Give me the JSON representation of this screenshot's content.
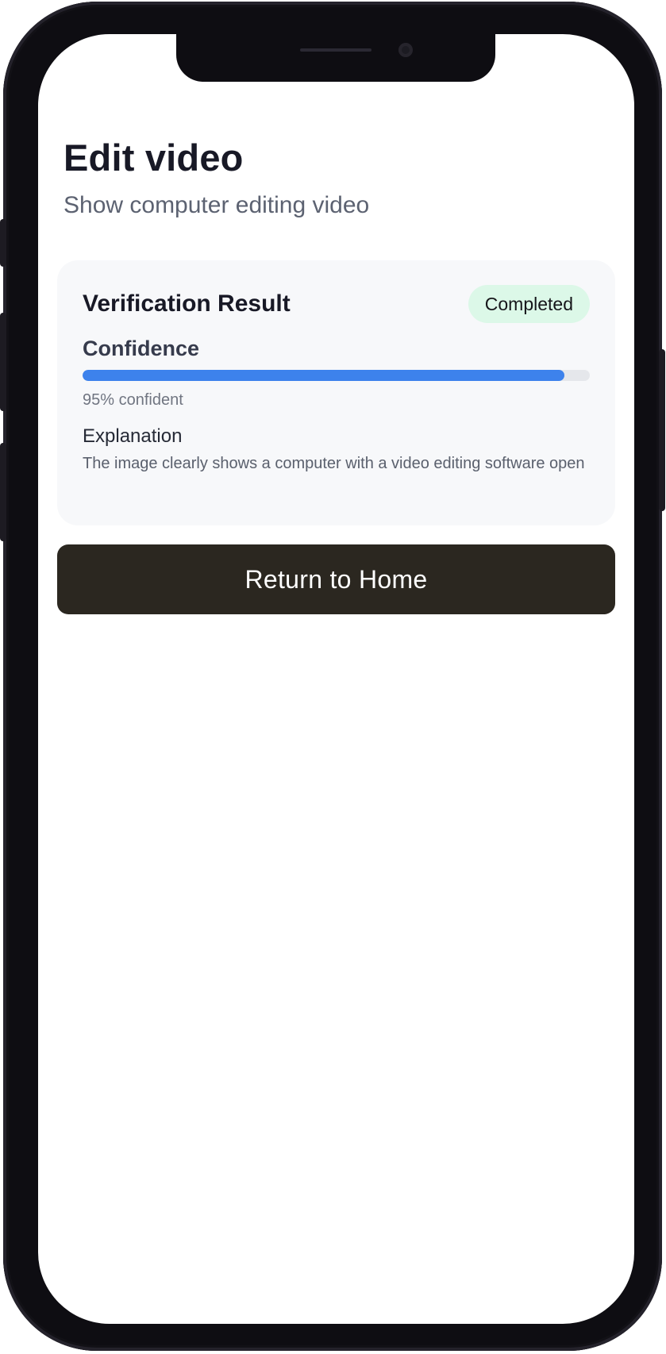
{
  "header": {
    "title": "Edit video",
    "subtitle": "Show computer editing video"
  },
  "result_card": {
    "title": "Verification Result",
    "status": "Completed",
    "status_color": "#dcf8e8",
    "confidence_label": "Confidence",
    "confidence_value": 0.95,
    "confidence_text": "95% confident",
    "progress_color": "#3d82ec",
    "explanation_label": "Explanation",
    "explanation_text": "The image clearly shows a computer with a video editing software open"
  },
  "actions": {
    "home_button_label": "Return to Home",
    "home_button_color": "#2b2720"
  }
}
